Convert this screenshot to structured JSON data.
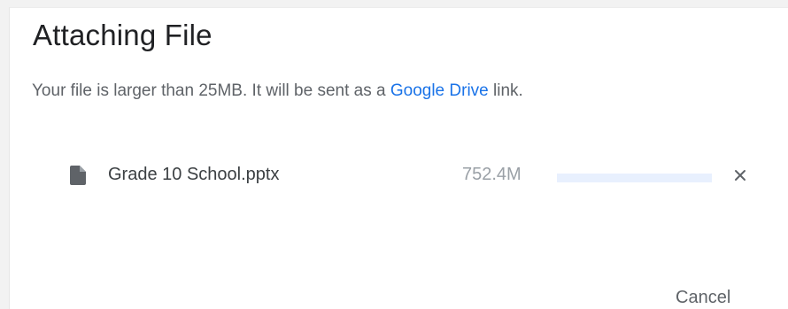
{
  "dialog": {
    "title": "Attaching File",
    "message_prefix": "Your file is larger than 25MB. It will be sent as a ",
    "message_link": "Google Drive",
    "message_suffix": " link."
  },
  "file": {
    "icon": "file-icon",
    "name": "Grade 10 School.pptx",
    "size": "752.4M",
    "progress_fraction": 0.0
  },
  "actions": {
    "cancel_label": "Cancel",
    "remove_icon": "close-icon"
  },
  "colors": {
    "link": "#1a73e8",
    "progress_track": "#e8f0fe",
    "title_text": "#202124",
    "body_text": "#5f6368"
  }
}
